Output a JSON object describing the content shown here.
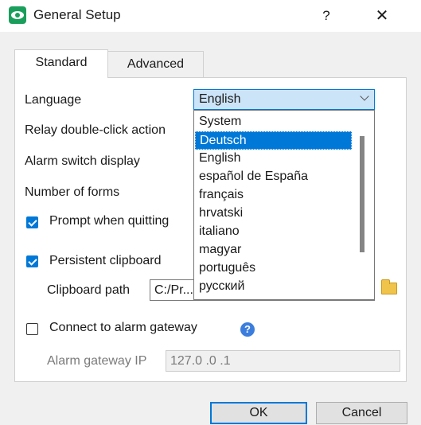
{
  "window": {
    "title": "General Setup",
    "help_glyph": "?",
    "close_glyph": "✕",
    "app_icon": "eye-icon"
  },
  "tabs": [
    {
      "label": "Standard",
      "active": true
    },
    {
      "label": "Advanced",
      "active": false
    }
  ],
  "form": {
    "language_label": "Language",
    "language_value": "English",
    "relay_label": "Relay double-click action",
    "alarm_switch_label": "Alarm switch display",
    "number_forms_label": "Number of forms",
    "prompt_quit_label": "Prompt when quitting",
    "prompt_quit_checked": true,
    "persistent_clipboard_label": "Persistent clipboard",
    "persistent_clipboard_checked": true,
    "clipboard_path_label": "Clipboard path",
    "clipboard_path_value": "C:/Pr...",
    "connect_gateway_label": "Connect to alarm gateway",
    "connect_gateway_checked": false,
    "gateway_ip_label": "Alarm gateway IP",
    "gateway_ip_value": "127.0  .0  .1"
  },
  "language_dropdown": {
    "options": [
      "System",
      "Deutsch",
      "English",
      "español de España",
      "français",
      "hrvatski",
      "italiano",
      "magyar",
      "português",
      "русский"
    ],
    "highlighted": "Deutsch"
  },
  "buttons": {
    "ok": "OK",
    "cancel": "Cancel"
  },
  "colors": {
    "accent": "#0078d7",
    "app_icon_green": "#1a9e5c",
    "combo_bg": "#cce4f7"
  }
}
